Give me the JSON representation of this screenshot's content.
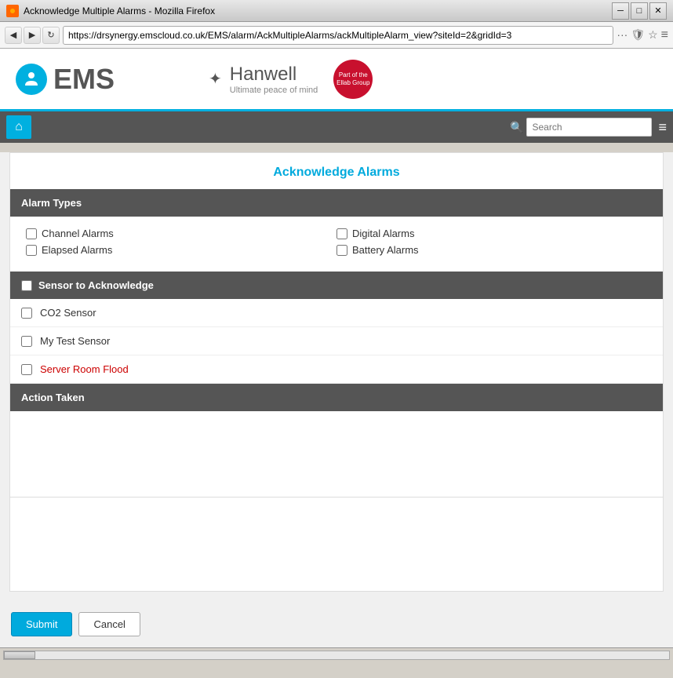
{
  "browser": {
    "title": "Acknowledge Multiple Alarms - Mozilla Firefox",
    "url": "https://drsynergy.emscloud.co.uk/EMS/alarm/AckMultipleAlarms/ackMultipleAlarm_view?siteId=2&gridId=3",
    "nav_back": "◀",
    "nav_forward": "▶",
    "nav_reload": "↻",
    "min_btn": "─",
    "max_btn": "□",
    "close_btn": "✕",
    "menu_dots": "···",
    "bookmark_icon": "☆",
    "shield_icon": "🛡"
  },
  "header": {
    "ems_logo_text": "EMS",
    "hanwell_title": "Hanwell",
    "hanwell_subtitle": "Ultimate peace of mind",
    "ellab_text": "Part of the Ellab Group",
    "ellab_badge": "ellab"
  },
  "nav": {
    "home_icon": "⌂",
    "search_placeholder": "Search",
    "search_label": "Search",
    "menu_icon": "≡"
  },
  "page": {
    "title": "Acknowledge Alarms",
    "alarm_types_section": "Alarm Types",
    "sensor_section": "Sensor to Acknowledge",
    "action_section": "Action Taken",
    "alarm_types": [
      {
        "id": "channel",
        "label": "Channel Alarms",
        "checked": false
      },
      {
        "id": "digital",
        "label": "Digital Alarms",
        "checked": false
      },
      {
        "id": "elapsed",
        "label": "Elapsed Alarms",
        "checked": false
      },
      {
        "id": "battery",
        "label": "Battery Alarms",
        "checked": false
      }
    ],
    "sensors": [
      {
        "id": "co2",
        "label": "CO2 Sensor",
        "checked": false,
        "red": false
      },
      {
        "id": "mytest",
        "label": "My Test Sensor",
        "checked": false,
        "red": false
      },
      {
        "id": "serverroom",
        "label": "Server Room Flood",
        "checked": false,
        "red": true
      }
    ],
    "submit_label": "Submit",
    "cancel_label": "Cancel"
  }
}
